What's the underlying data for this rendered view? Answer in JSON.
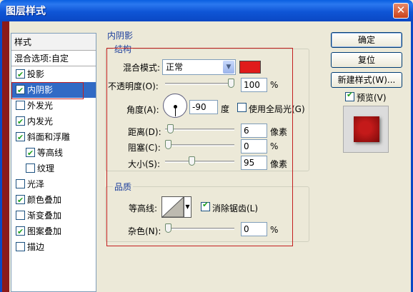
{
  "window": {
    "title": "图层样式",
    "close_glyph": "✕"
  },
  "styles_list": {
    "header": "样式",
    "blend_options": "混合选项:自定",
    "items": [
      {
        "label": "投影",
        "checked": true
      },
      {
        "label": "内阴影",
        "checked": true,
        "selected": true
      },
      {
        "label": "外发光",
        "checked": false
      },
      {
        "label": "内发光",
        "checked": true
      },
      {
        "label": "斜面和浮雕",
        "checked": true
      },
      {
        "label": "等高线",
        "checked": true,
        "sub": true
      },
      {
        "label": "纹理",
        "checked": false,
        "sub": true
      },
      {
        "label": "光泽",
        "checked": false
      },
      {
        "label": "颜色叠加",
        "checked": true
      },
      {
        "label": "渐变叠加",
        "checked": false
      },
      {
        "label": "图案叠加",
        "checked": true
      },
      {
        "label": "描边",
        "checked": false
      }
    ]
  },
  "inner_shadow": {
    "section_title": "内阴影",
    "structure": {
      "title": "结构",
      "blend_mode_label": "混合模式:",
      "blend_mode_value": "正常",
      "color": "#e01b1b",
      "opacity_label": "不透明度(O):",
      "opacity_value": "100",
      "opacity_unit": "%",
      "opacity_level": 1.0,
      "angle_label": "角度(A):",
      "angle_value": "-90",
      "angle_unit": "度",
      "global_light_label": "使用全局光(G)",
      "global_light_checked": false,
      "distance_label": "距离(D):",
      "distance_value": "6",
      "distance_unit": "像素",
      "distance_level": 0.03,
      "choke_label": "阻塞(C):",
      "choke_value": "0",
      "choke_unit": "%",
      "choke_level": 0.0,
      "size_label": "大小(S):",
      "size_value": "95",
      "size_unit": "像素",
      "size_level": 0.38
    },
    "quality": {
      "title": "品质",
      "contour_label": "等高线:",
      "antialias_label": "消除锯齿(L)",
      "antialias_checked": true,
      "noise_label": "杂色(N):",
      "noise_value": "0",
      "noise_unit": "%",
      "noise_level": 0.0
    }
  },
  "buttons": {
    "ok": "确定",
    "reset": "复位",
    "new_style": "新建样式(W)...",
    "preview_label": "预览(V)",
    "preview_checked": true
  },
  "colors": {
    "title_bar": "#0a48c4",
    "accent": "#316ac5",
    "group_title": "#1b3e9c",
    "highlight_outline": "#c41f1f"
  }
}
